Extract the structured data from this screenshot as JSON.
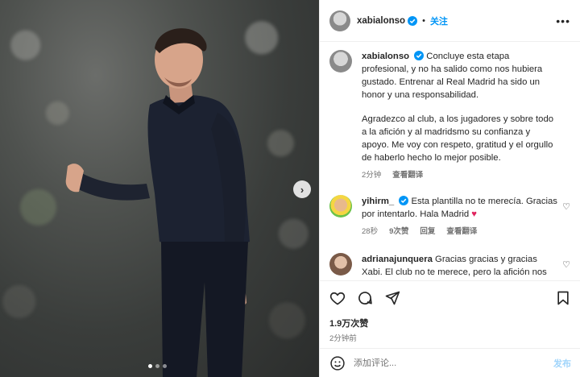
{
  "post": {
    "username": "xabialonso",
    "follow_label": "关注",
    "more_label": "•••",
    "caption_username": "xabialonso",
    "caption_p1": "Concluye esta etapa profesional, y no ha salido como nos hubiera gustado. Entrenar al Real Madrid ha sido un honor y una responsabilidad.",
    "caption_p2": "Agradezco al club, a los jugadores y sobre todo a la afición y al madridsmo su confianza y apoyo. Me voy con respeto, gratitud y el orgullo de haberlo hecho lo mejor posible.",
    "caption_time": "2分钟",
    "see_translation": "查看翻译",
    "likes": "1.9万次赞",
    "time": "2分钟前"
  },
  "comments": [
    {
      "username": "yihirm_",
      "text": "Esta plantilla no te merecía. Gracias por intentarlo. Hala Madrid ",
      "emoji": "♥",
      "time": "28秒",
      "likes": "9次赞",
      "reply": "回复",
      "translate": "查看翻译"
    },
    {
      "username": "adrianajunquera",
      "text": "Gracias gracias y gracias Xabi. El club no te merece, pero la afición nos quedamos con que más que el problema fuiste"
    }
  ],
  "composer": {
    "placeholder": "添加评论...",
    "post_label": "发布"
  },
  "icons": {
    "next": "chevron-right-icon",
    "emoji": "smiley-icon",
    "like": "heart-icon",
    "comment": "comment-icon",
    "share": "send-icon",
    "save": "bookmark-icon"
  },
  "colors": {
    "accent": "#0095f6",
    "muted": "#737373",
    "emoji_heart": "#e0245e"
  }
}
